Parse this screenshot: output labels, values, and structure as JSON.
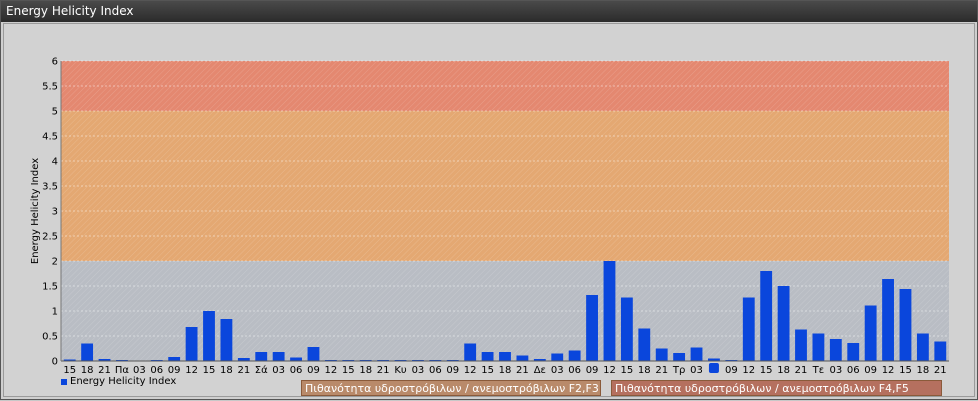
{
  "window": {
    "title": "Energy Helicity Index"
  },
  "colors": {
    "bar": "#0a46dc",
    "band_low": "#b9bdc4",
    "band_mid": "#e4a872",
    "band_high": "#e48870"
  },
  "legend": {
    "label": "Energy Helicity Index"
  },
  "bands": [
    {
      "label": "Πιθανότητα υδροστρόβιλων / ανεμοστρόβιλων F2,F3",
      "from": 2,
      "to": 5
    },
    {
      "label": "Πιθανότητα υδροστρόβιλων / ανεμοστρόβιλων F4,F5",
      "from": 5,
      "to": 6
    }
  ],
  "chart_data": {
    "type": "bar",
    "title": "Energy Helicity Index",
    "ylabel": "Energy Helicity Index",
    "xlabel": "",
    "ylim": [
      0,
      6
    ],
    "yticks": [
      "0",
      "0.5",
      "1",
      "1.5",
      "2",
      "2.5",
      "3",
      "3.5",
      "4",
      "4.5",
      "5",
      "5.5",
      "6"
    ],
    "grid": true,
    "legend_position": "bottom-left",
    "categories": [
      "15",
      "18",
      "21",
      "Πα",
      "03",
      "06",
      "09",
      "12",
      "15",
      "18",
      "21",
      "Σά",
      "03",
      "06",
      "09",
      "12",
      "15",
      "18",
      "21",
      "Κυ",
      "03",
      "06",
      "09",
      "12",
      "15",
      "18",
      "21",
      "Δε",
      "03",
      "06",
      "09",
      "12",
      "15",
      "18",
      "21",
      "Τρ",
      "03",
      "",
      "09",
      "12",
      "15",
      "18",
      "21",
      "Τε",
      "03",
      "06",
      "09",
      "12",
      "15",
      "18",
      "21"
    ],
    "series": [
      {
        "name": "Energy Helicity Index",
        "values": [
          0.03,
          0.35,
          0.04,
          0.02,
          0.01,
          0.02,
          0.08,
          0.68,
          1.0,
          0.84,
          0.06,
          0.18,
          0.18,
          0.07,
          0.28,
          0.02,
          0.02,
          0.02,
          0.02,
          0.02,
          0.02,
          0.02,
          0.02,
          0.35,
          0.18,
          0.18,
          0.11,
          0.04,
          0.15,
          0.21,
          1.32,
          2.0,
          1.27,
          0.65,
          0.25,
          0.16,
          0.27,
          0.05,
          0.02,
          1.27,
          1.8,
          1.5,
          0.63,
          0.55,
          0.44,
          0.36,
          1.11,
          1.64,
          1.44,
          0.55,
          0.39
        ]
      }
    ]
  }
}
